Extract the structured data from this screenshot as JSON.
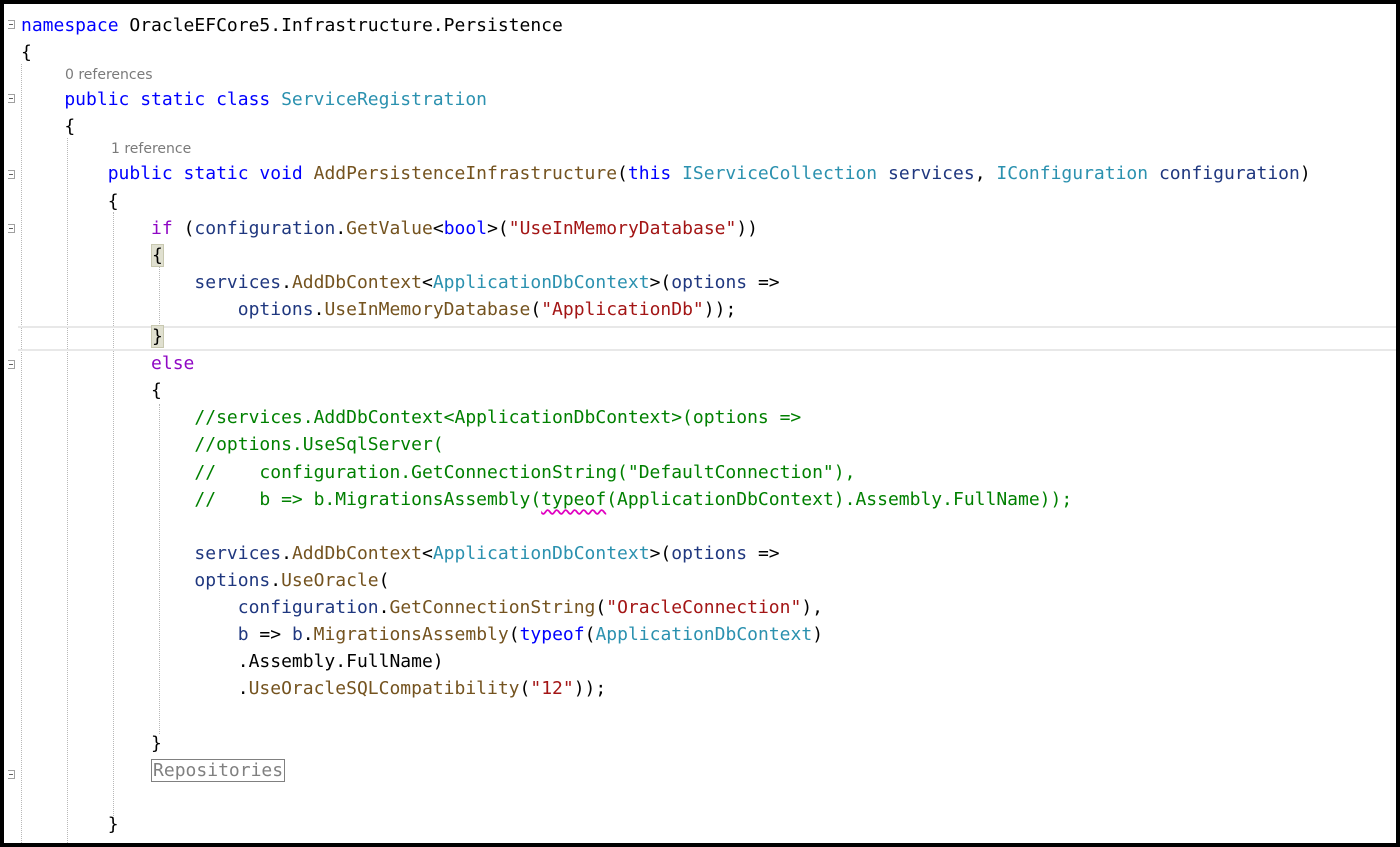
{
  "editor": {
    "lines": [
      [
        {
          "t": "namespace ",
          "c": "kw"
        },
        {
          "t": "OracleEFCore5.Infrastructure.Persistence",
          "c": "pl"
        }
      ],
      [
        {
          "t": "{",
          "c": "pl"
        }
      ],
      [
        {
          "t": "    public static class ",
          "c": "kw"
        },
        {
          "t": "ServiceRegistration",
          "c": "ty"
        }
      ],
      [
        {
          "t": "    {",
          "c": "pl"
        }
      ],
      [
        {
          "t": "        public static void ",
          "c": "kw"
        },
        {
          "t": "AddPersistenceInfrastructure",
          "c": "fn"
        },
        {
          "t": "(",
          "c": "pl"
        },
        {
          "t": "this ",
          "c": "kw"
        },
        {
          "t": "IServiceCollection",
          "c": "ty"
        },
        {
          "t": " ",
          "c": "pl"
        },
        {
          "t": "services",
          "c": "pm"
        },
        {
          "t": ", ",
          "c": "pl"
        },
        {
          "t": "IConfiguration",
          "c": "ty"
        },
        {
          "t": " ",
          "c": "pl"
        },
        {
          "t": "configuration",
          "c": "pm"
        },
        {
          "t": ")",
          "c": "pl"
        }
      ],
      [
        {
          "t": "        {",
          "c": "pl"
        }
      ],
      [
        {
          "t": "            ",
          "c": "pl"
        },
        {
          "t": "if",
          "c": "ctl"
        },
        {
          "t": " (",
          "c": "pl"
        },
        {
          "t": "configuration",
          "c": "pm"
        },
        {
          "t": ".",
          "c": "pl"
        },
        {
          "t": "GetValue",
          "c": "fn"
        },
        {
          "t": "<",
          "c": "pl"
        },
        {
          "t": "bool",
          "c": "kw"
        },
        {
          "t": ">(",
          "c": "pl"
        },
        {
          "t": "\"UseInMemoryDatabase\"",
          "c": "str"
        },
        {
          "t": "))",
          "c": "pl"
        }
      ],
      [
        {
          "t": "            ",
          "c": "pl"
        },
        {
          "t": "{",
          "c": "pl brace-hl"
        }
      ],
      [
        {
          "t": "                ",
          "c": "pl"
        },
        {
          "t": "services",
          "c": "pm"
        },
        {
          "t": ".",
          "c": "pl"
        },
        {
          "t": "AddDbContext",
          "c": "fn"
        },
        {
          "t": "<",
          "c": "pl"
        },
        {
          "t": "ApplicationDbContext",
          "c": "ty"
        },
        {
          "t": ">(",
          "c": "pl"
        },
        {
          "t": "options",
          "c": "pm"
        },
        {
          "t": " =>",
          "c": "pl"
        }
      ],
      [
        {
          "t": "                    ",
          "c": "pl"
        },
        {
          "t": "options",
          "c": "pm"
        },
        {
          "t": ".",
          "c": "pl"
        },
        {
          "t": "UseInMemoryDatabase",
          "c": "fn"
        },
        {
          "t": "(",
          "c": "pl"
        },
        {
          "t": "\"ApplicationDb\"",
          "c": "str"
        },
        {
          "t": "));",
          "c": "pl"
        }
      ],
      [
        {
          "t": "            ",
          "c": "pl"
        },
        {
          "t": "}",
          "c": "pl brace-hl"
        }
      ],
      [
        {
          "t": "            ",
          "c": "pl"
        },
        {
          "t": "else",
          "c": "ctl"
        }
      ],
      [
        {
          "t": "            {",
          "c": "pl"
        }
      ],
      [
        {
          "t": "                //services.AddDbContext<ApplicationDbContext>(options =>",
          "c": "cm"
        }
      ],
      [
        {
          "t": "                //options.UseSqlServer(",
          "c": "cm"
        }
      ],
      [
        {
          "t": "                //    configuration.GetConnectionString(\"DefaultConnection\"),",
          "c": "cm"
        }
      ],
      [
        {
          "t": "                //    b => b.MigrationsAssembly(",
          "c": "cm"
        },
        {
          "t": "typeof",
          "c": "cm squiggle"
        },
        {
          "t": "(ApplicationDbContext).Assembly.FullName));",
          "c": "cm"
        }
      ],
      [
        {
          "t": "",
          "c": "pl"
        }
      ],
      [
        {
          "t": "                ",
          "c": "pl"
        },
        {
          "t": "services",
          "c": "pm"
        },
        {
          "t": ".",
          "c": "pl"
        },
        {
          "t": "AddDbContext",
          "c": "fn"
        },
        {
          "t": "<",
          "c": "pl"
        },
        {
          "t": "ApplicationDbContext",
          "c": "ty"
        },
        {
          "t": ">(",
          "c": "pl"
        },
        {
          "t": "options",
          "c": "pm"
        },
        {
          "t": " =>",
          "c": "pl"
        }
      ],
      [
        {
          "t": "                ",
          "c": "pl"
        },
        {
          "t": "options",
          "c": "pm"
        },
        {
          "t": ".",
          "c": "pl"
        },
        {
          "t": "UseOracle",
          "c": "fn"
        },
        {
          "t": "(",
          "c": "pl"
        }
      ],
      [
        {
          "t": "                    ",
          "c": "pl"
        },
        {
          "t": "configuration",
          "c": "pm"
        },
        {
          "t": ".",
          "c": "pl"
        },
        {
          "t": "GetConnectionString",
          "c": "fn"
        },
        {
          "t": "(",
          "c": "pl"
        },
        {
          "t": "\"OracleConnection\"",
          "c": "str"
        },
        {
          "t": "),",
          "c": "pl"
        }
      ],
      [
        {
          "t": "                    ",
          "c": "pl"
        },
        {
          "t": "b",
          "c": "pm"
        },
        {
          "t": " => ",
          "c": "pl"
        },
        {
          "t": "b",
          "c": "pm"
        },
        {
          "t": ".",
          "c": "pl"
        },
        {
          "t": "MigrationsAssembly",
          "c": "fn"
        },
        {
          "t": "(",
          "c": "pl"
        },
        {
          "t": "typeof",
          "c": "kw"
        },
        {
          "t": "(",
          "c": "pl"
        },
        {
          "t": "ApplicationDbContext",
          "c": "ty"
        },
        {
          "t": ")",
          "c": "pl"
        }
      ],
      [
        {
          "t": "                    .Assembly.FullName)",
          "c": "pl"
        }
      ],
      [
        {
          "t": "                    .",
          "c": "pl"
        },
        {
          "t": "UseOracleSQLCompatibility",
          "c": "fn"
        },
        {
          "t": "(",
          "c": "pl"
        },
        {
          "t": "\"12\"",
          "c": "str"
        },
        {
          "t": "));",
          "c": "pl"
        }
      ],
      [
        {
          "t": "",
          "c": "pl"
        }
      ],
      [
        {
          "t": "            }",
          "c": "pl"
        }
      ],
      [
        {
          "t": "            ",
          "c": "pl"
        },
        {
          "t": "Repositories",
          "c": "region"
        }
      ],
      [
        {
          "t": "",
          "c": "pl"
        }
      ],
      [
        {
          "t": "        }",
          "c": "pl"
        }
      ]
    ],
    "codelens": [
      {
        "text": "0 references",
        "after_line": 1
      },
      {
        "text": "1 reference",
        "after_line": 3
      }
    ]
  }
}
